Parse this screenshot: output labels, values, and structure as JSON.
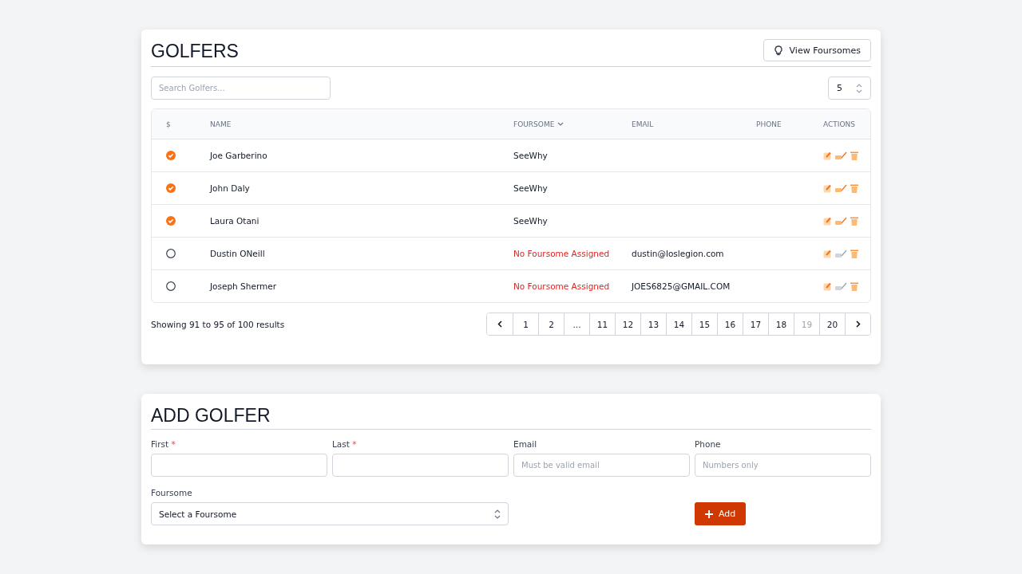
{
  "golfers": {
    "title": "GOLFERS",
    "view_button": "View Foursomes",
    "search": {
      "placeholder": "Search Golfers..."
    },
    "per_page": "5",
    "columns": [
      {
        "label": "$",
        "sort": false
      },
      {
        "label": "NAME",
        "sort": false
      },
      {
        "label": "FOURSOME",
        "sort": true
      },
      {
        "label": "EMAIL",
        "sort": false
      },
      {
        "label": "PHONE",
        "sort": false
      },
      {
        "label": "ACTIONS",
        "sort": false
      }
    ],
    "rows": [
      {
        "paid": true,
        "name": "Joe Garberino",
        "foursome": "SeeWhy",
        "assigned": true
      },
      {
        "paid": true,
        "name": "John Daly",
        "foursome": "SeeWhy",
        "assigned": true
      },
      {
        "paid": true,
        "name": "Laura Otani",
        "foursome": "SeeWhy",
        "assigned": true
      },
      {
        "paid": false,
        "name": "Dustin ONeill",
        "foursome": "No Foursome Assigned",
        "assigned": false,
        "email": "dustin@loslegion.com"
      },
      {
        "paid": false,
        "name": "Joseph Shermer",
        "foursome": "No Foursome Assigned",
        "assigned": false,
        "email": "JOES6825@GMAIL.COM"
      }
    ],
    "summary": "Showing 91 to 95 of 100 results",
    "pages": [
      {
        "label": "1",
        "selected": false
      },
      {
        "label": "2",
        "selected": false
      },
      {
        "label": "...",
        "selected": false
      },
      {
        "label": "11",
        "selected": false
      },
      {
        "label": "12",
        "selected": false
      },
      {
        "label": "13",
        "selected": false
      },
      {
        "label": "14",
        "selected": false
      },
      {
        "label": "15",
        "selected": false
      },
      {
        "label": "16",
        "selected": false
      },
      {
        "label": "17",
        "selected": false
      },
      {
        "label": "18",
        "selected": false
      },
      {
        "label": "19",
        "selected": true
      },
      {
        "label": "20",
        "selected": false
      }
    ]
  },
  "add_golfer": {
    "title": "ADD GOLFER",
    "fields": [
      {
        "label": "First",
        "required_mark": "*"
      },
      {
        "label": "Last",
        "required_mark": "*"
      },
      {
        "label": "Email",
        "placeholder": "Must be valid email"
      },
      {
        "label": "Phone",
        "placeholder": "Numbers only"
      }
    ],
    "foursome": {
      "label": "Foursome",
      "value": "Select a Foursome"
    },
    "add_button": "Add"
  }
}
